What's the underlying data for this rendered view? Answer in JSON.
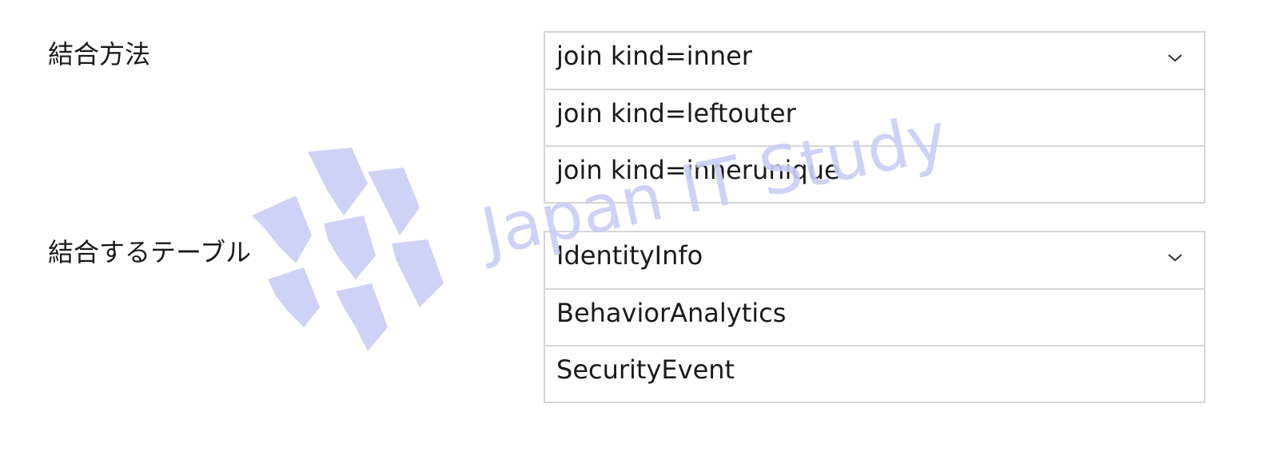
{
  "join_method": {
    "label": "結合方法",
    "selected": "join kind=inner",
    "options": [
      "join kind=leftouter",
      "join kind=innerunique"
    ]
  },
  "join_table": {
    "label": "結合するテーブル",
    "selected": "IdentityInfo",
    "options": [
      "BehaviorAnalytics",
      "SecurityEvent"
    ]
  },
  "watermark": {
    "text": "Japan IT Study",
    "color": "#c9cef7"
  },
  "icons": {
    "dropdown": "chevron-down-icon",
    "logo": "chevron-logo"
  }
}
